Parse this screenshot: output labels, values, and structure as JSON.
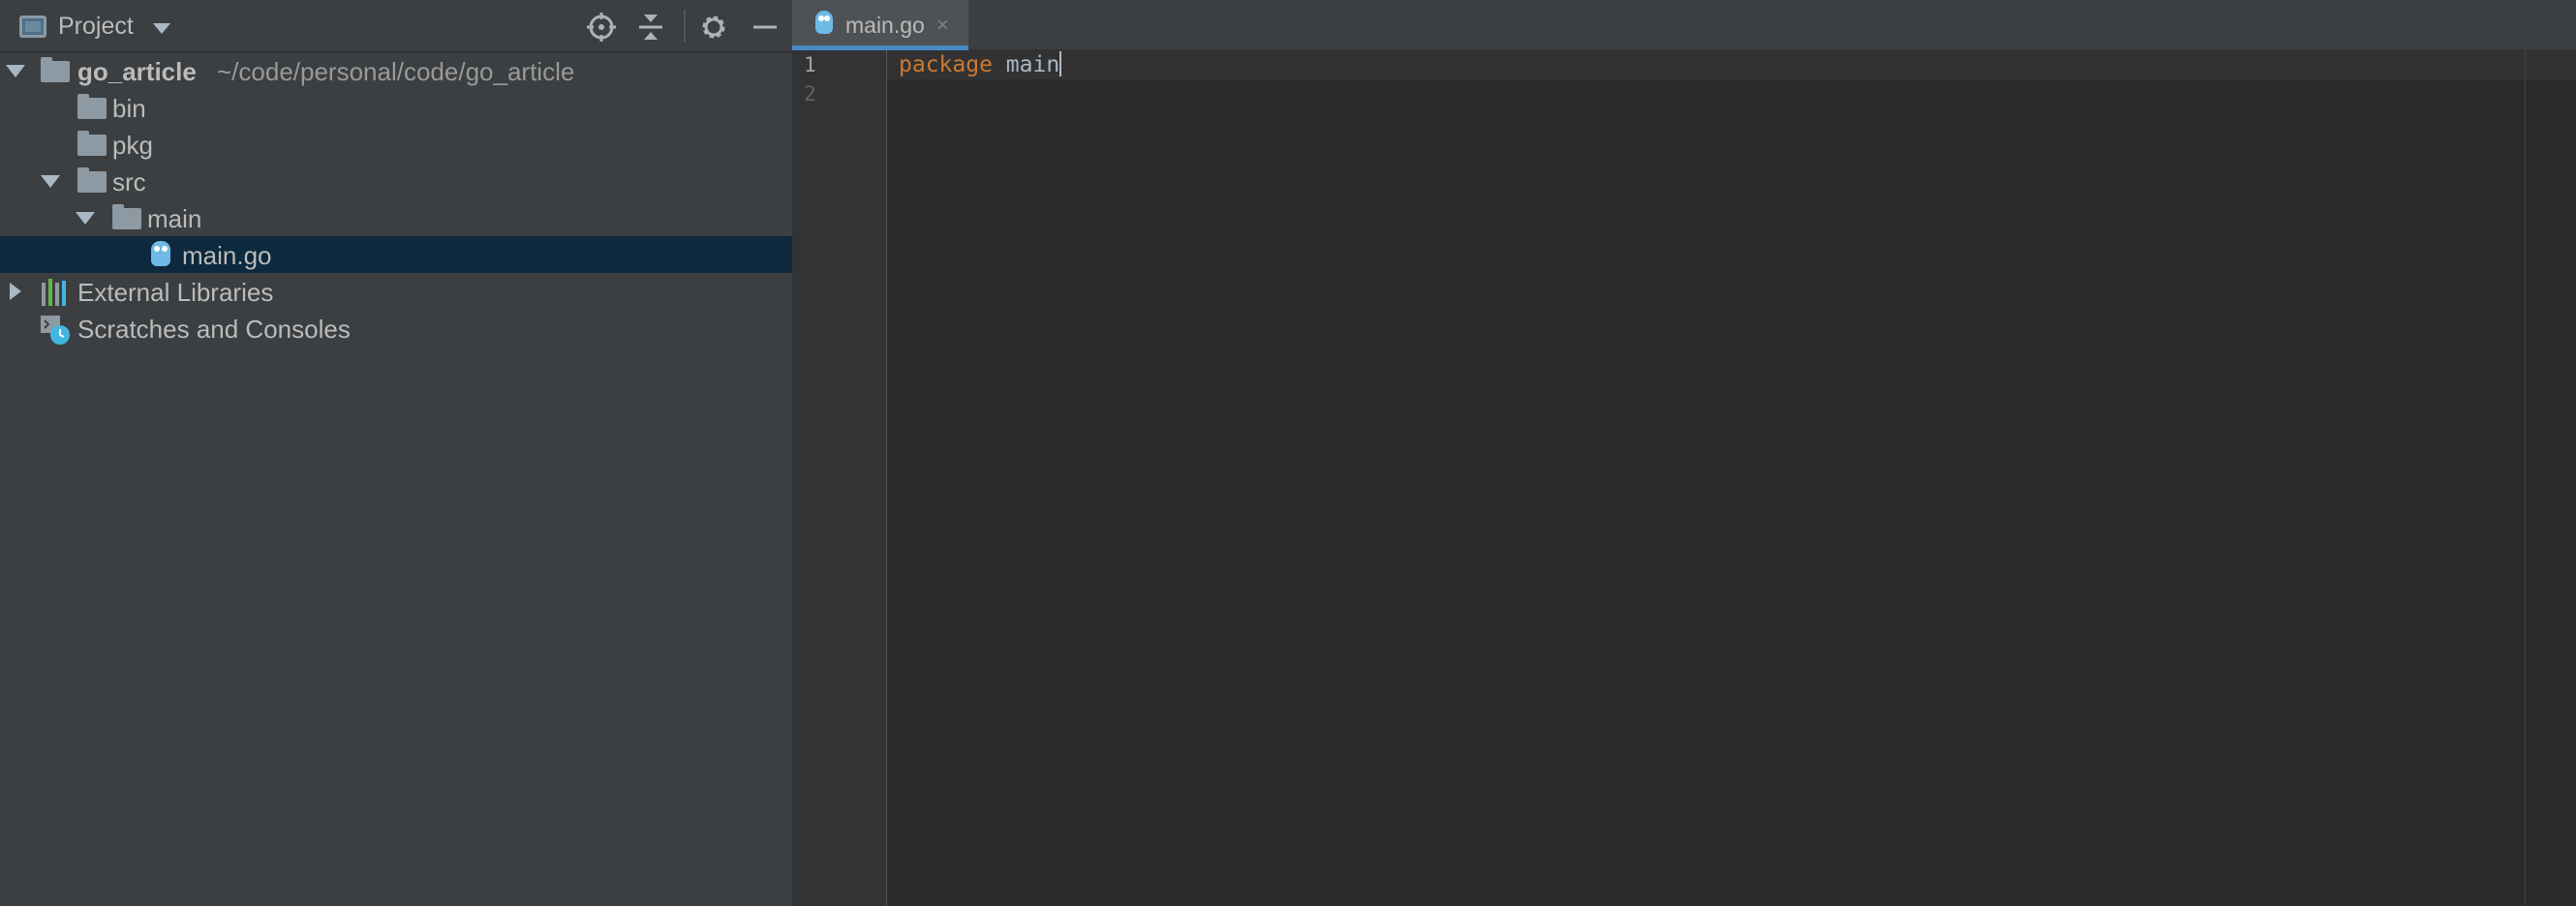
{
  "project_panel": {
    "title": "Project",
    "toolbar": {
      "locate_icon": "crosshair-icon",
      "collapse_icon": "collapse-all-icon",
      "settings_icon": "gear-icon",
      "hide_icon": "minimize-icon"
    },
    "tree": {
      "root": {
        "name": "go_article",
        "path": "~/code/personal/code/go_article"
      },
      "items": [
        {
          "name": "bin"
        },
        {
          "name": "pkg"
        },
        {
          "name": "src"
        },
        {
          "name": "main"
        },
        {
          "name": "main.go",
          "selected": true
        }
      ],
      "external_libraries": "External Libraries",
      "scratches": "Scratches and Consoles"
    }
  },
  "editor": {
    "tab": {
      "label": "main.go",
      "close": "×"
    },
    "line_numbers": [
      "1",
      "2"
    ],
    "code": {
      "keyword": "package",
      "identifier": "main"
    }
  },
  "colors": {
    "panel_bg": "#3c3f41",
    "editor_bg": "#2b2b2b",
    "selection": "#0d293e",
    "keyword": "#cc7832",
    "accent": "#4a88c7"
  }
}
